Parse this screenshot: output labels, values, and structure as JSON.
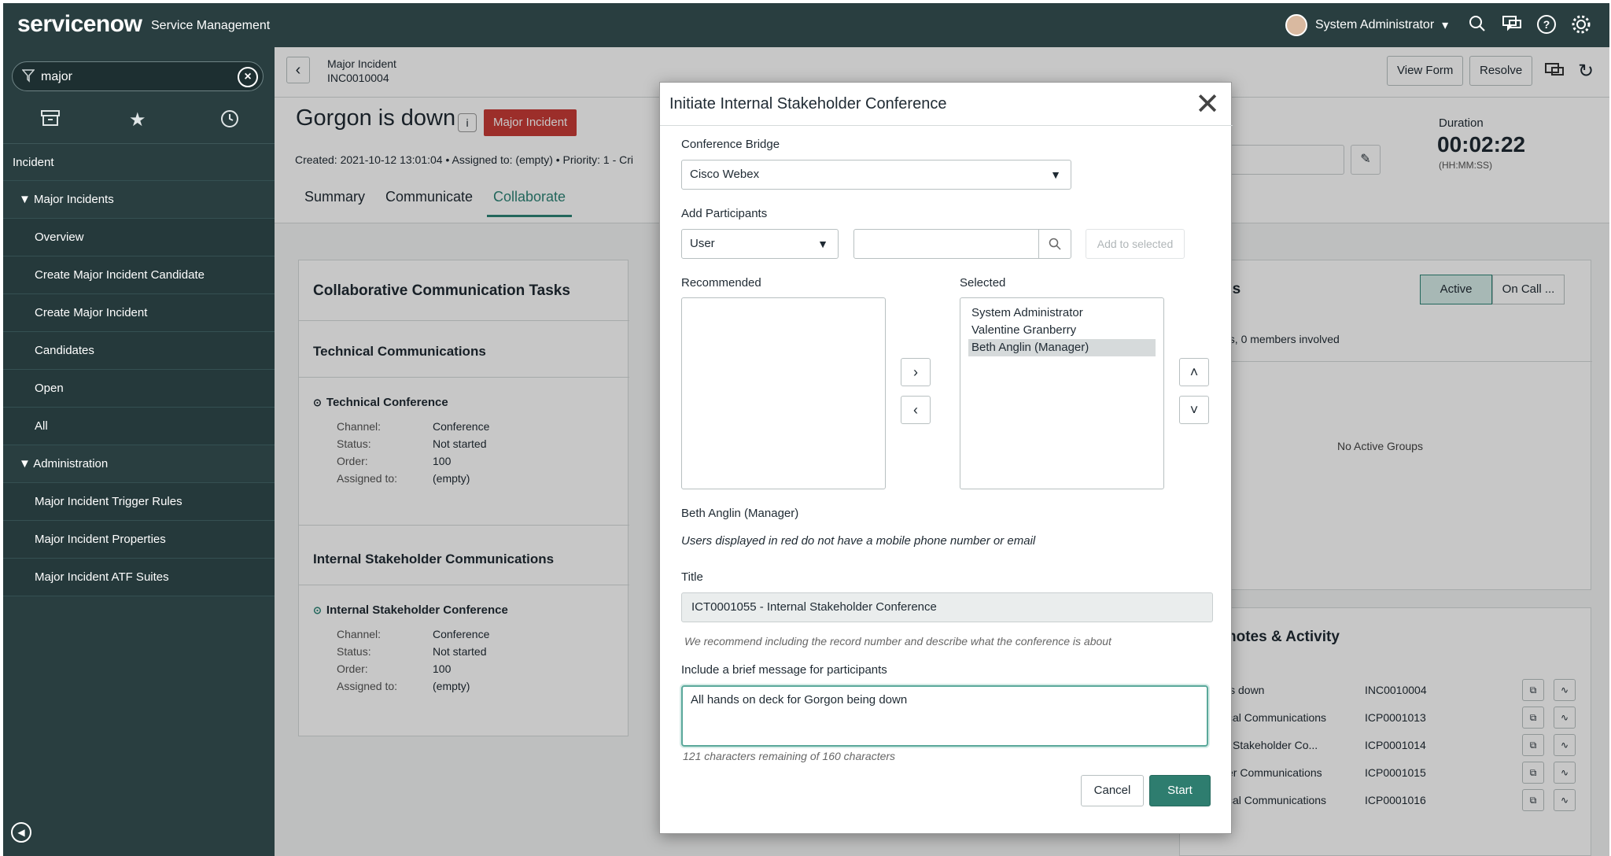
{
  "topbar": {
    "logo": "servicenow",
    "product": "Service Management",
    "user_name": "System Administrator",
    "caret": "▾",
    "icons": [
      "search-icon",
      "chat-icon",
      "help-icon",
      "settings-icon"
    ]
  },
  "sidebar": {
    "filter_value": "major",
    "app_title": "Incident",
    "items": [
      {
        "label": "Major Incidents",
        "type": "header"
      },
      {
        "label": "Overview",
        "type": "link"
      },
      {
        "label": "Create Major Incident Candidate",
        "type": "link"
      },
      {
        "label": "Create Major Incident",
        "type": "link"
      },
      {
        "label": "Candidates",
        "type": "link"
      },
      {
        "label": "Open",
        "type": "link"
      },
      {
        "label": "All",
        "type": "link"
      },
      {
        "label": "Administration",
        "type": "header"
      },
      {
        "label": "Major Incident Trigger Rules",
        "type": "link"
      },
      {
        "label": "Major Incident Properties",
        "type": "link"
      },
      {
        "label": "Major Incident ATF Suites",
        "type": "link"
      }
    ]
  },
  "header": {
    "record_type": "Major Incident",
    "record_number": "INC0010004",
    "view_form": "View Form",
    "resolve": "Resolve"
  },
  "incident": {
    "title": "Gorgon is down",
    "badge": "Major Incident",
    "created_line": "Created: 2021-10-12 13:01:04  •  Assigned to: (empty)  •  Priority: 1 - Cri",
    "duration_label": "Duration",
    "duration_value": "00:02:22",
    "duration_format": "(HH:MM:SS)"
  },
  "tabs": [
    "Summary",
    "Communicate",
    "Collaborate"
  ],
  "tasks": {
    "title": "Collaborative Communication Tasks",
    "sections": [
      {
        "name": "Technical Communications",
        "item": "Technical Conference",
        "fields": [
          [
            "Channel:",
            "Conference"
          ],
          [
            "Status:",
            "Not started"
          ],
          [
            "Order:",
            "100"
          ],
          [
            "Assigned to:",
            "(empty)"
          ]
        ]
      },
      {
        "name": "Internal Stakeholder Communications",
        "item": "Internal Stakeholder Conference",
        "fields": [
          [
            "Channel:",
            "Conference"
          ],
          [
            "Status:",
            "Not started"
          ],
          [
            "Order:",
            "100"
          ],
          [
            "Assigned to:",
            "(empty)"
          ]
        ]
      }
    ]
  },
  "groups": {
    "title_fragment": "ps",
    "active": "Active",
    "oncall": "On Call ...",
    "summary_fragment": "ps, 0 members involved",
    "empty": "No Active Groups"
  },
  "activity": {
    "title_fragment": "notes & Activity",
    "rows": [
      {
        "name": "is down",
        "number": "INC0010004"
      },
      {
        "name": "cal Communications",
        "number": "ICP0001013"
      },
      {
        "name": "l Stakeholder Co...",
        "number": "ICP0001014"
      },
      {
        "name": "er Communications",
        "number": "ICP0001015"
      },
      {
        "name": "cal Communications",
        "number": "ICP0001016"
      }
    ]
  },
  "modal": {
    "title": "Initiate Internal Stakeholder Conference",
    "bridge_label": "Conference Bridge",
    "bridge_value": "Cisco Webex",
    "participants_label": "Add Participants",
    "participant_type": "User",
    "add_to_selected": "Add to selected",
    "recommended_label": "Recommended",
    "selected_label": "Selected",
    "selected": [
      "System Administrator",
      "Valentine Granberry",
      "Beth Anglin (Manager)"
    ],
    "selected_highlight_index": 2,
    "selected_detail": "Beth Anglin (Manager)",
    "red_note": "Users displayed in red do not have a mobile phone number or email",
    "title_label": "Title",
    "title_value": "ICT0001055 - Internal Stakeholder Conference",
    "title_hint": "We recommend including the record number and describe what the conference is about",
    "message_label": "Include a brief message for participants",
    "message_value": "All hands on deck for Gorgon being down",
    "counter": "121 characters remaining of 160 characters",
    "cancel": "Cancel",
    "start": "Start"
  },
  "colors": {
    "nav_bg": "#293e40",
    "accent": "#2e8477",
    "badge_red": "#c83c36",
    "start_btn": "#2e7d6f"
  }
}
